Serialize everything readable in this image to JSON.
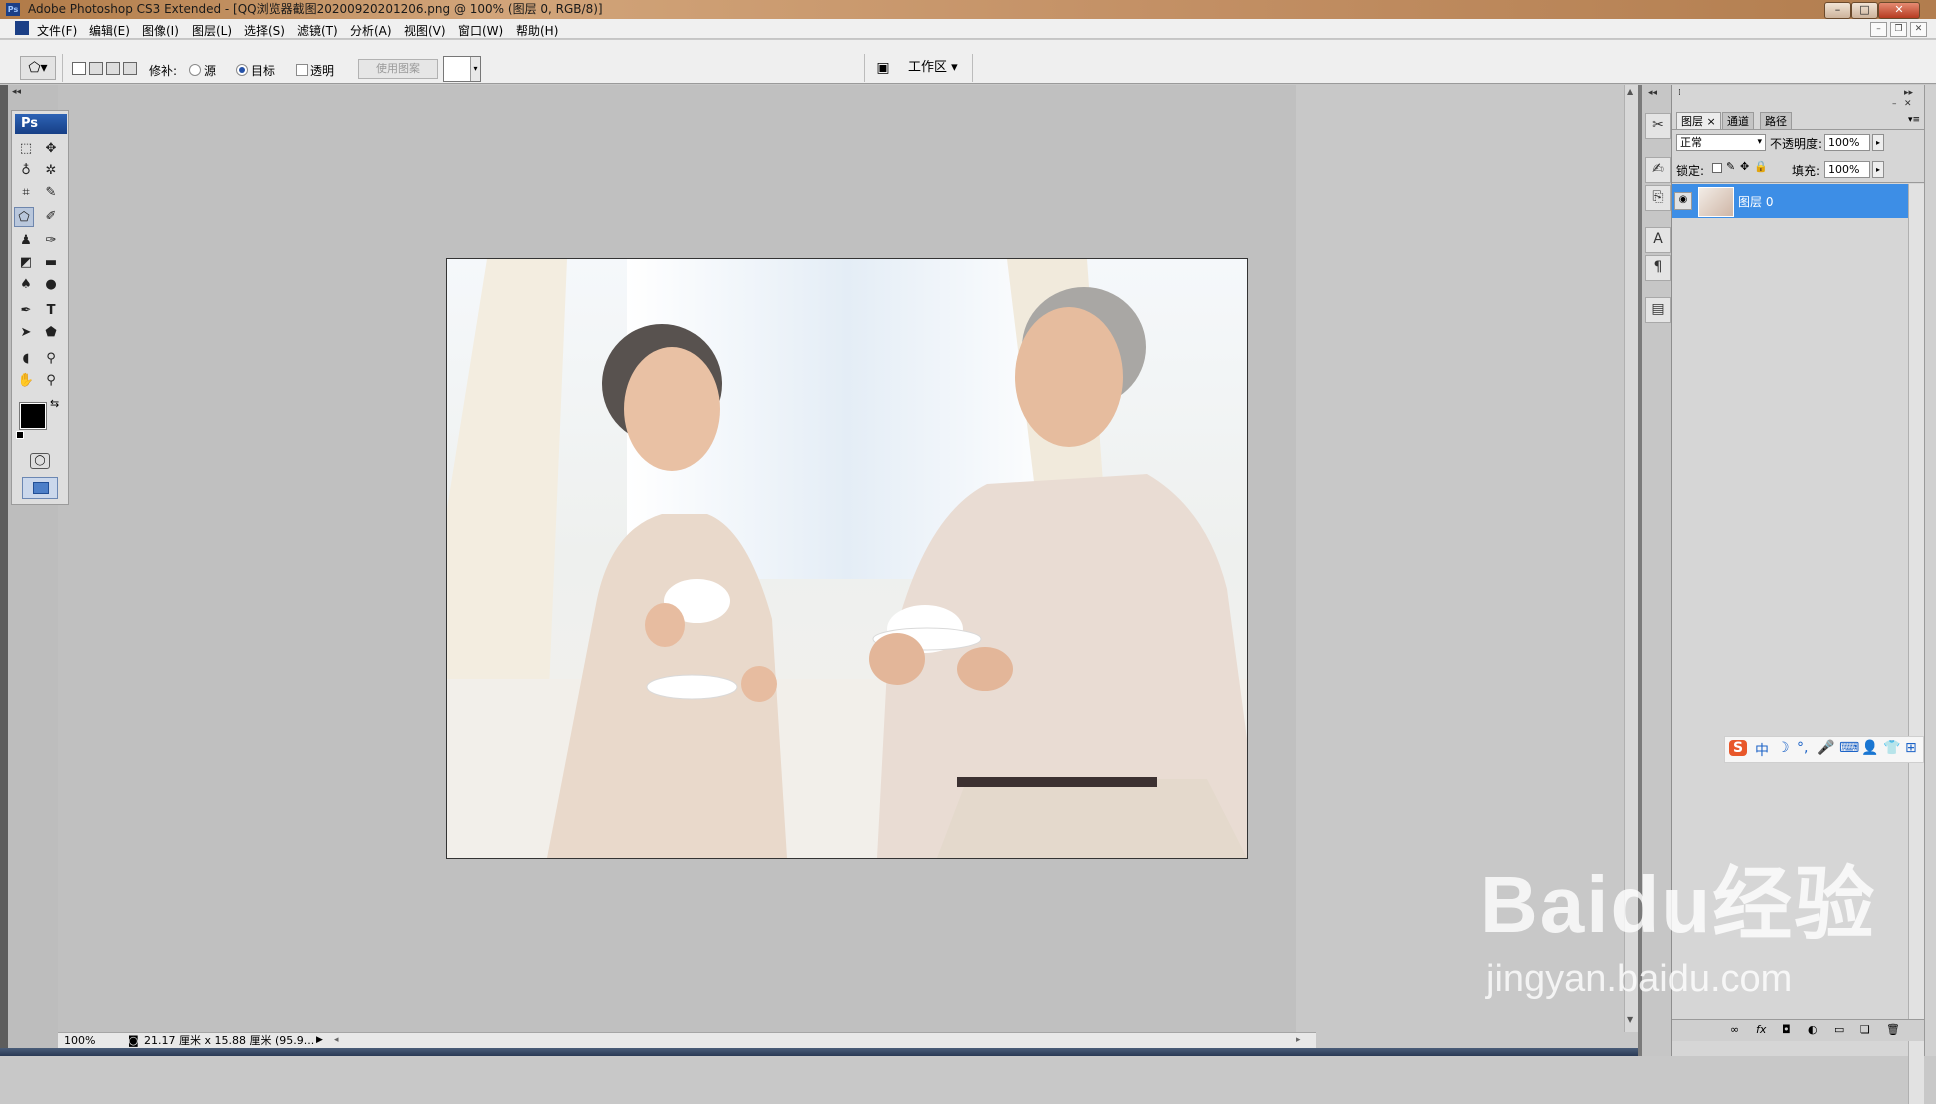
{
  "window": {
    "title": "Adobe Photoshop CS3 Extended - [QQ浏览器截图20200920201206.png @ 100% (图层 0, RGB/8)]",
    "buttons": [
      "–",
      "□",
      "✕"
    ],
    "mdi_buttons": [
      "–",
      "❐",
      "✕"
    ]
  },
  "menu": {
    "items": [
      "文件(F)",
      "编辑(E)",
      "图像(I)",
      "图层(L)",
      "选择(S)",
      "滤镜(T)",
      "分析(A)",
      "视图(V)",
      "窗口(W)",
      "帮助(H)"
    ]
  },
  "options": {
    "patch_label": "修补:",
    "source_label": "源",
    "target_label": "目标",
    "transparent_label": "透明",
    "use_pattern_label": "使用图案",
    "workspace_label": "工作区 ▾"
  },
  "toolbox": {
    "badge": "Ps"
  },
  "status": {
    "zoom": "100%",
    "doc_info": "21.17 厘米 x 15.88 厘米 (95.9..."
  },
  "layers_panel": {
    "tabs": [
      "图层 ×",
      "通道",
      "路径"
    ],
    "blend_mode": "正常",
    "opacity_label": "不透明度:",
    "opacity_value": "100%",
    "lock_label": "锁定:",
    "fill_label": "填充:",
    "fill_value": "100%",
    "layers": [
      {
        "name": "图层 0",
        "selected": true,
        "visible": true
      }
    ]
  },
  "ime": {
    "chars": [
      "S",
      "中",
      "☽",
      "°,",
      "🎤",
      "⌨",
      "👤",
      "👕",
      "⊞"
    ]
  },
  "watermark": {
    "line1": "Baidu经验",
    "line2": "jingyan.baidu.com"
  },
  "colors": {
    "layer_selected": "#3d8ee6",
    "ps_blue": "#1b3f86",
    "titlebar": "#c39065"
  }
}
